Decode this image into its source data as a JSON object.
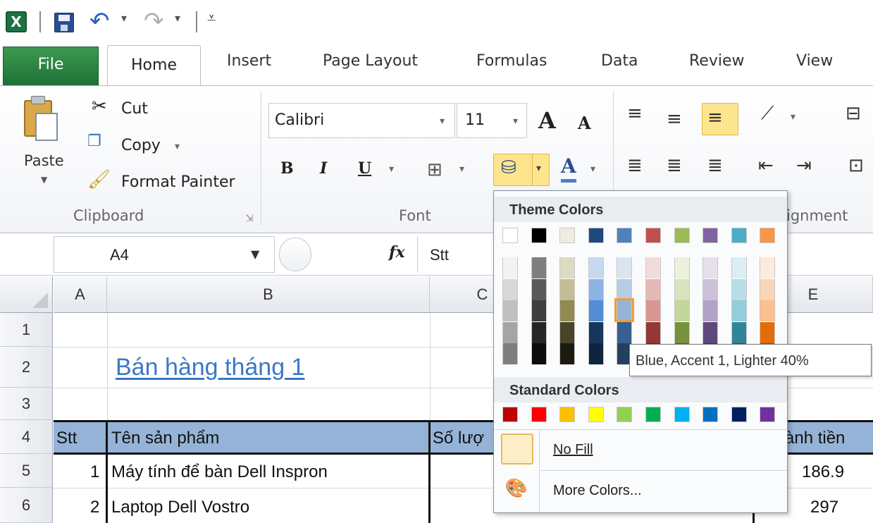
{
  "quick_access": {
    "app_icon": "excel-logo-icon",
    "app_letter": "X",
    "icons": [
      "save-icon",
      "undo-icon",
      "redo-icon",
      "customize-icon"
    ]
  },
  "tabs": [
    "File",
    "Home",
    "Insert",
    "Page Layout",
    "Formulas",
    "Data",
    "Review",
    "View"
  ],
  "clipboard": {
    "paste": "Paste",
    "cut": "Cut",
    "copy": "Copy",
    "format_painter": "Format Painter",
    "label": "Clipboard"
  },
  "font_group": {
    "font_name": "Calibri",
    "font_size": "11",
    "bold": "B",
    "italic": "I",
    "underline": "U",
    "font_color_letter": "A",
    "grow_font": "A",
    "shrink_font": "A",
    "label": "Font"
  },
  "alignment_group": {
    "label_visible": "ignment"
  },
  "formula_bar": {
    "name_box": "A4",
    "fx": "fx",
    "value": "Stt"
  },
  "columns": [
    "A",
    "B",
    "C",
    "E"
  ],
  "rows": [
    "1",
    "2",
    "3",
    "4",
    "5",
    "6"
  ],
  "sheet": {
    "title": "Bán hàng tháng 1",
    "header": {
      "stt": "Stt",
      "name": "Tên sản phẩm",
      "qty": "Số lượ",
      "total": "ành tiền"
    },
    "rows": [
      {
        "stt": "1",
        "name": "Máy tính để bàn Dell Inspron",
        "total": "186.9"
      },
      {
        "stt": "2",
        "name": "Laptop Dell Vostro",
        "total": "297"
      }
    ]
  },
  "palette": {
    "theme_heading": "Theme Colors",
    "standard_heading": "Standard Colors",
    "no_fill": "No Fill",
    "more_colors": "More Colors...",
    "theme_colors": [
      "#ffffff",
      "#000000",
      "#eeece1",
      "#1f497d",
      "#4f81bd",
      "#c0504d",
      "#9bbb59",
      "#8064a2",
      "#4bacc6",
      "#f79646"
    ],
    "theme_shades": [
      [
        "#f2f2f2",
        "#7f7f7f",
        "#ddd9c3",
        "#c6d9f0",
        "#dbe5f1",
        "#f2dcdb",
        "#ebf1dd",
        "#e5e0ec",
        "#dbeef3",
        "#fdeada"
      ],
      [
        "#d8d8d8",
        "#595959",
        "#c4bd97",
        "#8db3e2",
        "#b8cce4",
        "#e5b9b7",
        "#d7e3bc",
        "#ccc1d9",
        "#b7dde8",
        "#fbd5b5"
      ],
      [
        "#bfbfbf",
        "#3f3f3f",
        "#938953",
        "#548dd4",
        "#95b3d7",
        "#d99694",
        "#c3d69b",
        "#b2a2c7",
        "#92cddc",
        "#fac08f"
      ],
      [
        "#a5a5a5",
        "#262626",
        "#494429",
        "#17365d",
        "#366092",
        "#953734",
        "#76923c",
        "#5f497a",
        "#31859b",
        "#e36c09"
      ],
      [
        "#7f7f7f",
        "#0c0c0c",
        "#1d1b10",
        "#0f243e",
        "#244061",
        "#632423",
        "#4f6128",
        "#3f3151",
        "#205867",
        "#974806"
      ]
    ],
    "standard_colors": [
      "#c00000",
      "#ff0000",
      "#ffc000",
      "#ffff00",
      "#92d050",
      "#00b050",
      "#00b0f0",
      "#0070c0",
      "#002060",
      "#7030a0"
    ],
    "selected_color": "#95b3d7",
    "tooltip": "Blue, Accent 1, Lighter 40%"
  }
}
